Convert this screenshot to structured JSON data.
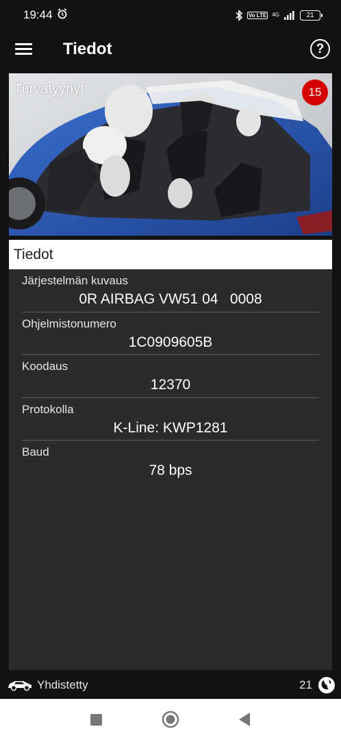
{
  "status_bar": {
    "time": "19:44",
    "alarm_icon": "alarm-icon",
    "bluetooth_icon": "bluetooth-icon",
    "volte": "Vo LTE",
    "network": "4G",
    "battery": "21"
  },
  "app_bar": {
    "title": "Tiedot",
    "menu_icon": "hamburger-menu-icon",
    "help_icon": "help-icon",
    "help_glyph": "?"
  },
  "hero": {
    "label": "Turvatyynyt",
    "badge": "15"
  },
  "panel": {
    "header": "Tiedot",
    "rows": [
      {
        "label": "Järjestelmän kuvaus",
        "value": "0R AIRBAG VW51 04   0008"
      },
      {
        "label": "Ohjelmistonumero",
        "value": "1C0909605B"
      },
      {
        "label": "Koodaus",
        "value": "12370"
      },
      {
        "label": "Protokolla",
        "value": "K-Line: KWP1281"
      },
      {
        "label": "Baud",
        "value": "78 bps"
      }
    ]
  },
  "bottom_status": {
    "connection_label": "Yhdistetty",
    "count": "21"
  },
  "colors": {
    "background": "#121212",
    "panel": "#2b2b2b",
    "badge": "#d50000",
    "car_blue": "#2a57b3"
  }
}
